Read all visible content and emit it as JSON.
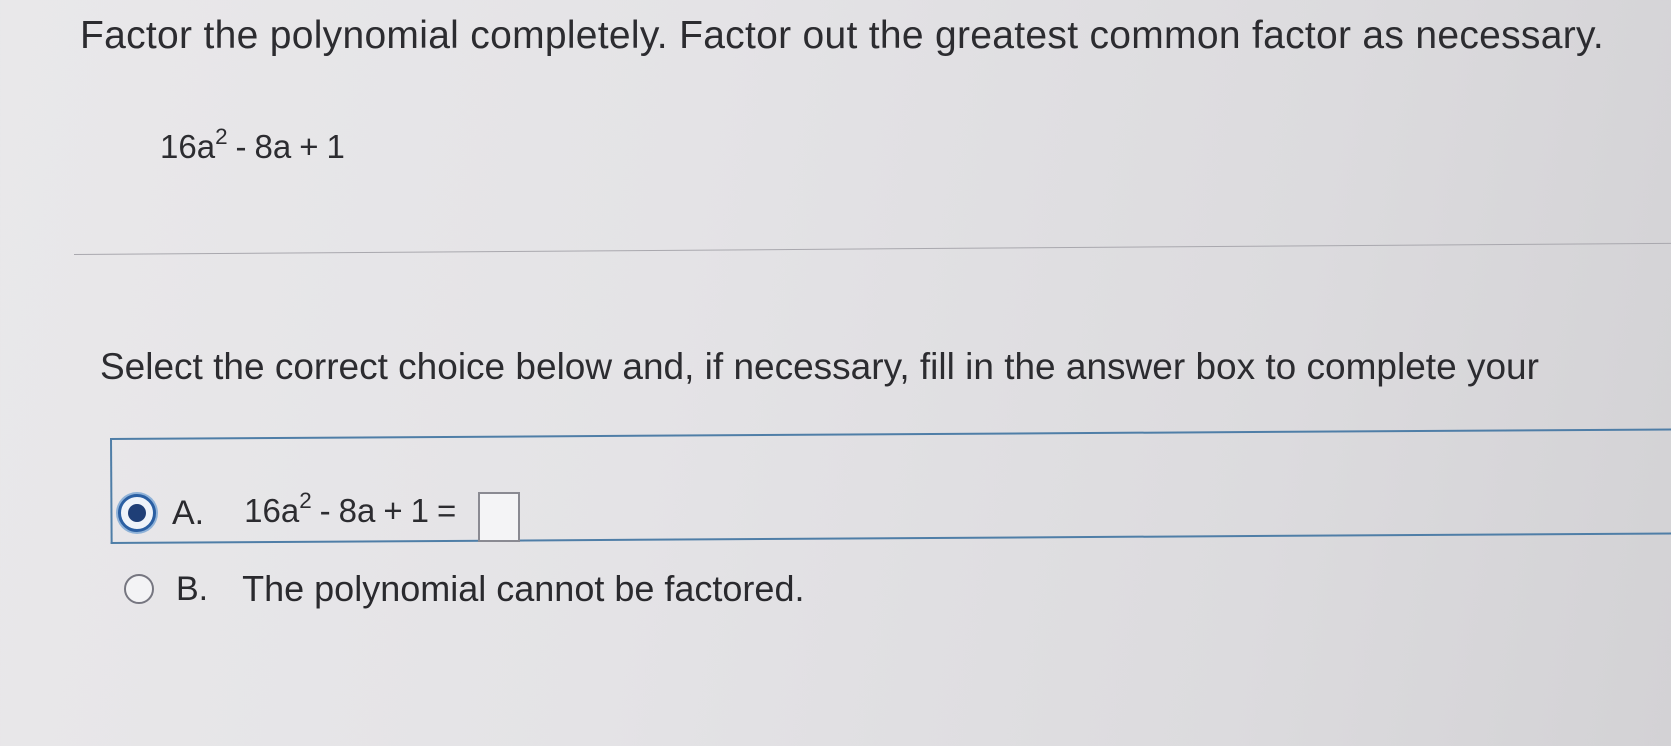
{
  "question": {
    "instruction": "Factor the polynomial completely. Factor out the greatest common factor as necessary.",
    "polynomial": {
      "term1": "16a",
      "exponent": "2",
      "op1": "-",
      "term2": "8a",
      "op2": "+",
      "term3": "1"
    }
  },
  "prompt": "Select the correct choice below and, if necessary, fill in the answer box to complete your",
  "choices": [
    {
      "letter": "A.",
      "selected": true,
      "expr": {
        "term1": "16a",
        "exponent": "2",
        "op1": "-",
        "term2": "8a",
        "op2": "+",
        "term3": "1",
        "equals": "="
      },
      "answer_value": ""
    },
    {
      "letter": "B.",
      "selected": false,
      "text": "The polynomial cannot be factored."
    }
  ],
  "colors": {
    "accent": "#2a5fa3",
    "selection_border": "#4f7ea7"
  }
}
